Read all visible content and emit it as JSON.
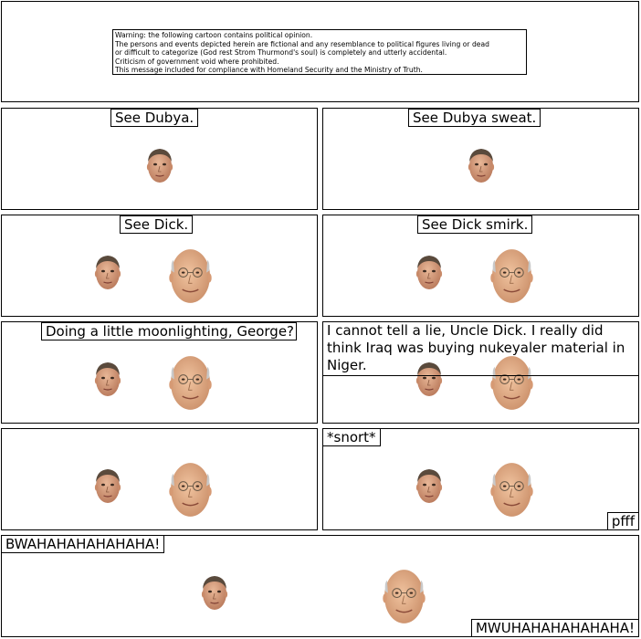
{
  "disclaimer": {
    "line1": "Warning: the following cartoon contains political opinion.",
    "line2": "The persons and events depicted herein are fictional and any resemblance to political figures living or dead",
    "line3": "or difficult to categorize (God rest Strom Thurmond's soul) is completely and utterly accidental.",
    "line4": "Criticism of government void where prohibited.",
    "line5": "This message included for compliance with Homeland Security and the Ministry of Truth."
  },
  "panels": {
    "p1": {
      "caption": "See Dubya."
    },
    "p2": {
      "caption": "See Dubya sweat."
    },
    "p3": {
      "caption": "See Dick."
    },
    "p4": {
      "caption": "See Dick smirk."
    },
    "p5": {
      "caption": "Doing a little moonlighting, George?"
    },
    "p6": {
      "caption": "I cannot tell a lie, Uncle Dick. I really did think Iraq was buying nukeyaler material in Niger."
    },
    "p8": {
      "caption_top": "*snort*",
      "caption_bottom": "pfff"
    },
    "p9": {
      "caption_left": "BWAHAHAHAHAHAHA!",
      "caption_right": "MWUHAHAHAHAHAHA!"
    }
  },
  "colors": {
    "skin": "#d9a07f",
    "skin_dark": "#b97a5c",
    "hair_dark": "#5a4a3c",
    "hair_grey": "#c9c9c9"
  }
}
